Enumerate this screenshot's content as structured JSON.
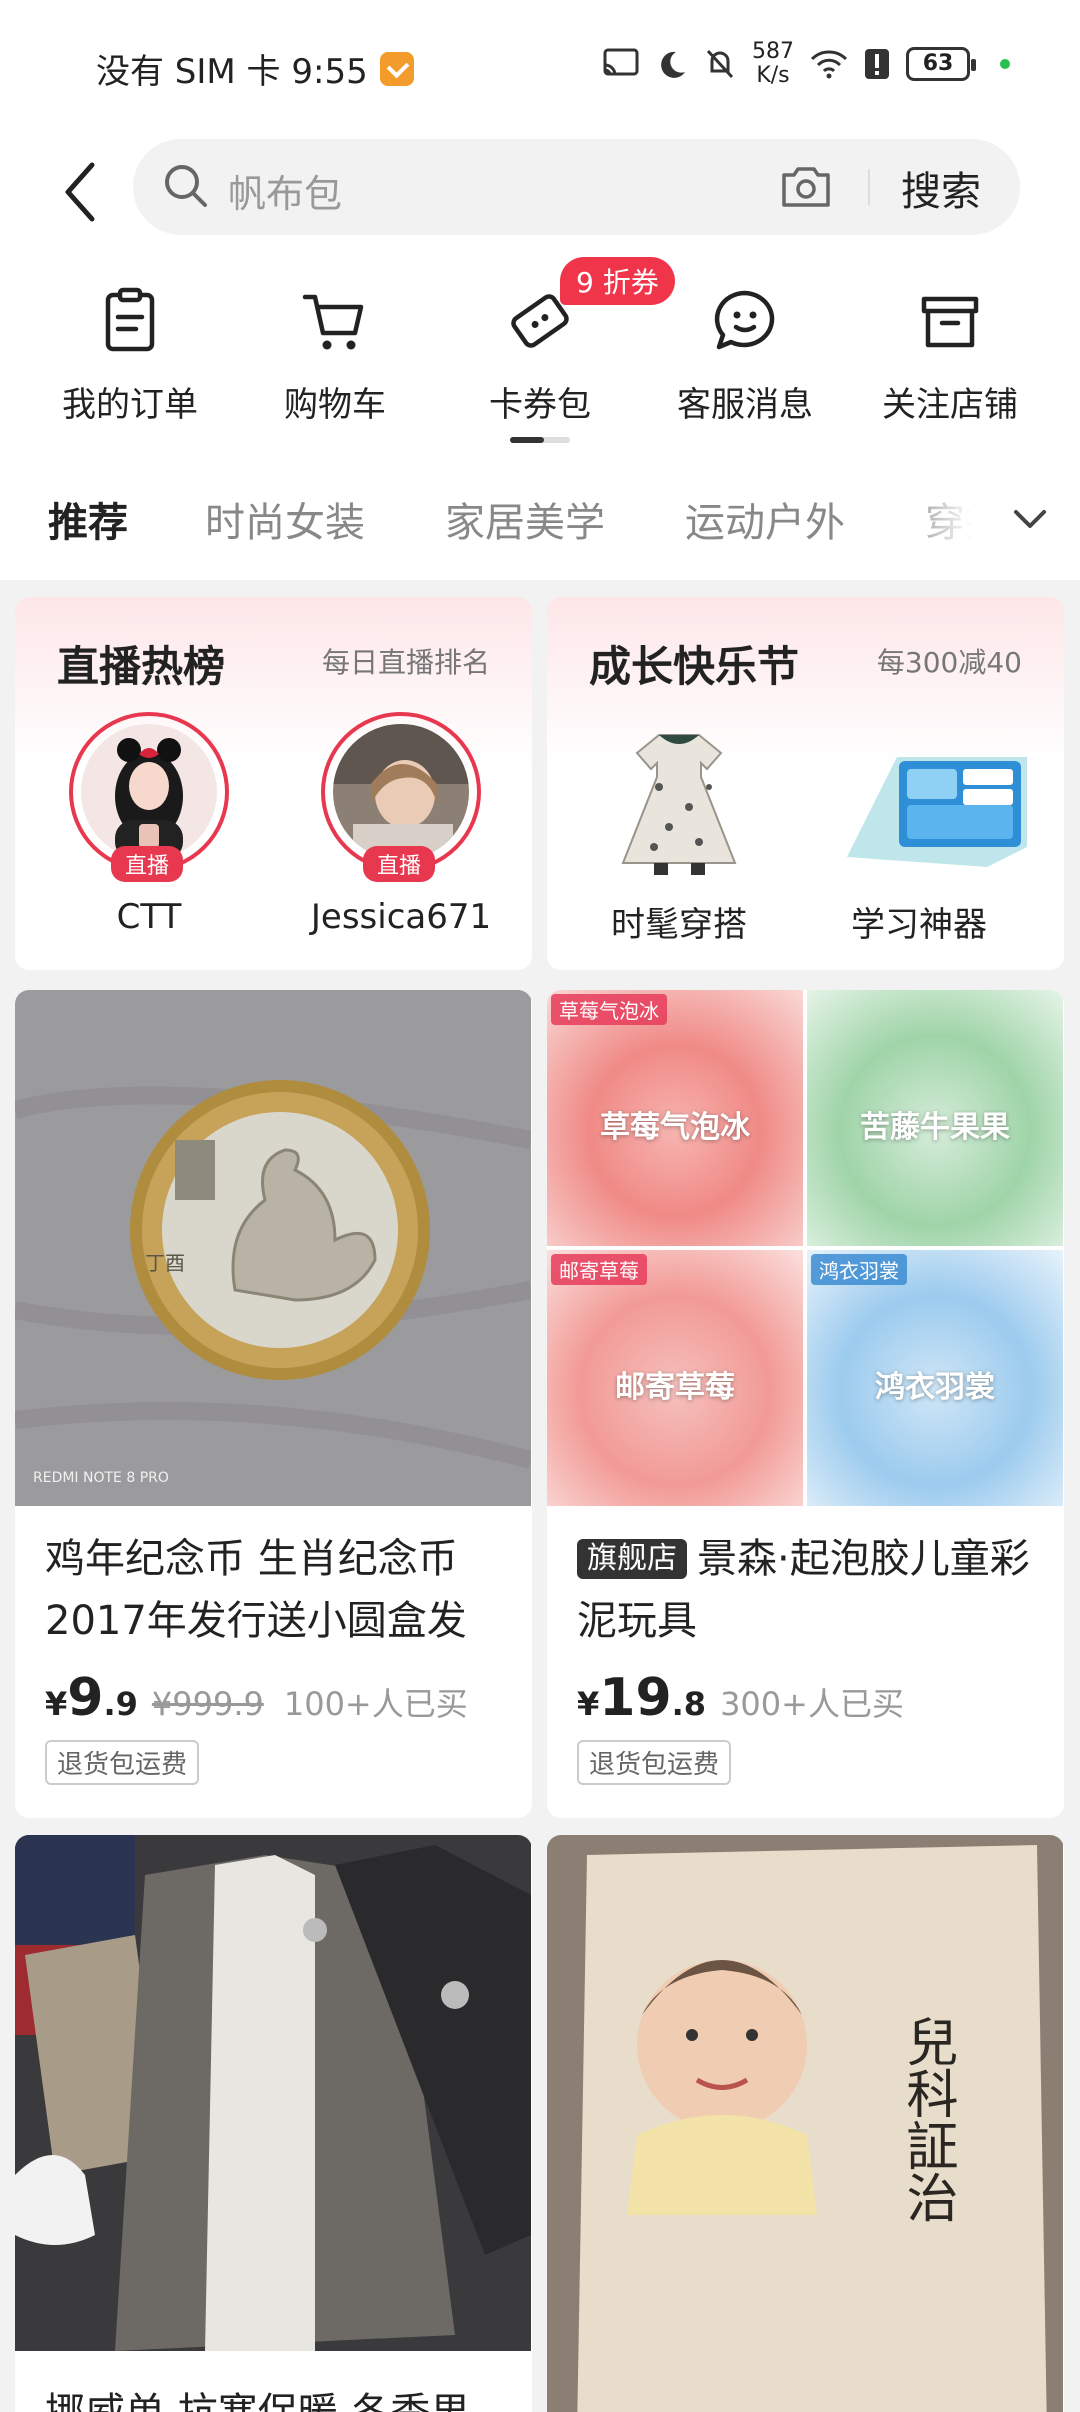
{
  "status_bar": {
    "carrier_time": "没有 SIM 卡 9:55",
    "net_speed_value": "587",
    "net_speed_unit": "K/s",
    "battery": "63"
  },
  "search": {
    "placeholder": "帆布包",
    "button_label": "搜索"
  },
  "shortcuts": [
    {
      "label": "我的订单",
      "icon": "order-icon"
    },
    {
      "label": "购物车",
      "icon": "cart-icon"
    },
    {
      "label": "卡券包",
      "icon": "coupon-icon",
      "badge": "9 折券"
    },
    {
      "label": "客服消息",
      "icon": "chat-icon"
    },
    {
      "label": "关注店铺",
      "icon": "store-icon"
    }
  ],
  "categories": [
    "推荐",
    "时尚女装",
    "家居美学",
    "运动户外",
    "穿搭"
  ],
  "active_category": "推荐",
  "promo_live": {
    "title": "直播热榜",
    "subtitle": "每日直播排名",
    "live_label": "直播",
    "streamers": [
      "CTT",
      "Jessica671"
    ]
  },
  "promo_growth": {
    "title": "成长快乐节",
    "subtitle": "每300减40",
    "items": [
      "时髦穿搭",
      "学习神器"
    ]
  },
  "products": [
    {
      "title": "鸡年纪念币 生肖纪念币2017年发行送小圆盒发",
      "price_symbol": "¥",
      "price_int": "9",
      "price_dec": ".9",
      "price_old": "¥999.9",
      "sold": "100+人已买",
      "tag": "退货包运费",
      "image_text": "REDMI NOTE 8 PRO"
    },
    {
      "flag": "旗舰店",
      "title": "景森·起泡胶儿童彩泥玩具",
      "price_symbol": "¥",
      "price_int": "19",
      "price_dec": ".8",
      "sold": "300+人已买",
      "tag": "退货包运费",
      "image_texts": [
        "草莓气泡冰",
        "苦藤牛果果",
        "邮寄草莓",
        "鸿衣羽裳"
      ],
      "image_corners": [
        "草莓气泡冰",
        "邮寄草莓",
        "鸿衣羽裳"
      ]
    },
    {
      "title": "挪威单 抗寒保暖 冬季男"
    },
    {
      "image_text": "兒科証治"
    }
  ],
  "colors": {
    "accent_red": "#f0344a",
    "live_red": "#e8384f",
    "background": "#f2f2f2"
  }
}
